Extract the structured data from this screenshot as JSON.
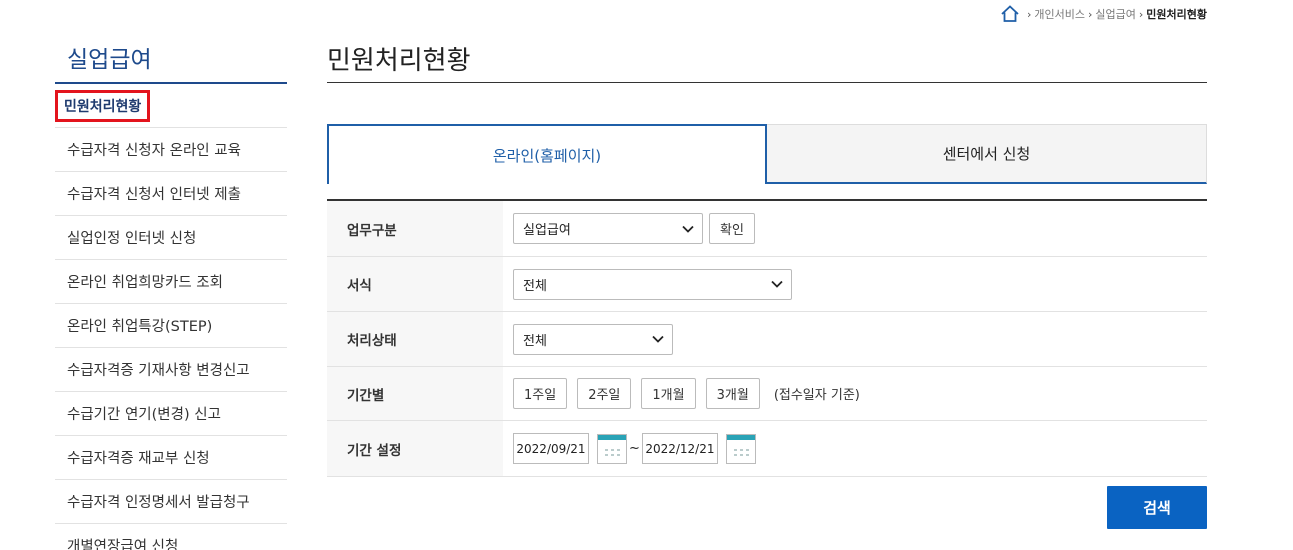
{
  "breadcrumb": {
    "items": [
      "개인서비스",
      "실업급여"
    ],
    "current": "민원처리현황"
  },
  "sidebar": {
    "title": "실업급여",
    "items": [
      {
        "label": "민원처리현황",
        "active": true
      },
      {
        "label": "수급자격 신청자 온라인 교육"
      },
      {
        "label": "수급자격 신청서 인터넷 제출"
      },
      {
        "label": "실업인정 인터넷 신청"
      },
      {
        "label": "온라인 취업희망카드 조회"
      },
      {
        "label": "온라인 취업특강(STEP)"
      },
      {
        "label": "수급자격증 기재사항 변경신고"
      },
      {
        "label": "수급기간 연기(변경) 신고"
      },
      {
        "label": "수급자격증 재교부 신청"
      },
      {
        "label": "수급자격 인정명세서 발급청구"
      },
      {
        "label": "개별연장급여 신청"
      }
    ]
  },
  "main": {
    "title": "민원처리현황",
    "tabs": [
      {
        "label": "온라인(홈페이지)",
        "active": true
      },
      {
        "label": "센터에서 신청",
        "active": false
      }
    ],
    "form": {
      "work_type": {
        "label": "업무구분",
        "value": "실업급여",
        "confirm": "확인"
      },
      "form_type": {
        "label": "서식",
        "value": "전체"
      },
      "status": {
        "label": "처리상태",
        "value": "전체"
      },
      "period": {
        "label": "기간별",
        "options": [
          "1주일",
          "2주일",
          "1개월",
          "3개월"
        ],
        "note": "(접수일자 기준)"
      },
      "date_range": {
        "label": "기간 설정",
        "from": "2022/09/21",
        "sep": "~",
        "to": "2022/12/21"
      }
    },
    "search_label": "검색"
  },
  "colors": {
    "accent": "#1f5fa8",
    "search_button": "#0a63c2",
    "highlight_box": "#e3141d",
    "sidebar_title": "#1e4a8c"
  }
}
